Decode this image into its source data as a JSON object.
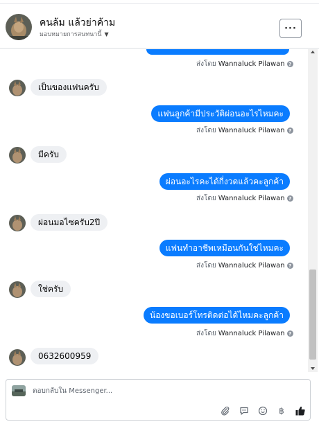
{
  "header": {
    "name": "คนล้ม แล้วย่าค้าม",
    "assign_label": "มอบหมายการสนทนานี้",
    "more_label": "···"
  },
  "thread": {
    "sent_by_prefix": "ส่งโดย",
    "sender": "Wannaluck Pilawan",
    "messages": [
      {
        "dir": "in",
        "text": "เป็นของแฟนครับ"
      },
      {
        "dir": "out",
        "text": "แฟนลูกค้ามีประวัติผ่อนอะไรไหมคะ"
      },
      {
        "dir": "in",
        "text": "มีครับ"
      },
      {
        "dir": "out",
        "text": "ผ่อนอะไรคะได้กี่งวดแล้วคะลูกค้า"
      },
      {
        "dir": "in",
        "text": "ผ่อนมอไซครับ2ปี"
      },
      {
        "dir": "out",
        "text": "แฟนทำอาชีพเหมือนกันใช่ไหมคะ"
      },
      {
        "dir": "in",
        "text": "ใช่ครับ"
      },
      {
        "dir": "out",
        "text": "น้องขอเบอร์โทรติดต่อได้ไหมคะลูกค้า"
      },
      {
        "dir": "in",
        "text": "0632600959"
      }
    ]
  },
  "composer": {
    "placeholder": "ตอบกลับใน Messenger..."
  },
  "tools": [
    "paperclip-icon",
    "comment-icon",
    "emoji-icon",
    "baht-icon",
    "thumbs-up-icon"
  ],
  "colors": {
    "outgoing_bubble": "#0a7cff",
    "incoming_bubble": "#eef0f3",
    "like": "#1c1e21"
  }
}
